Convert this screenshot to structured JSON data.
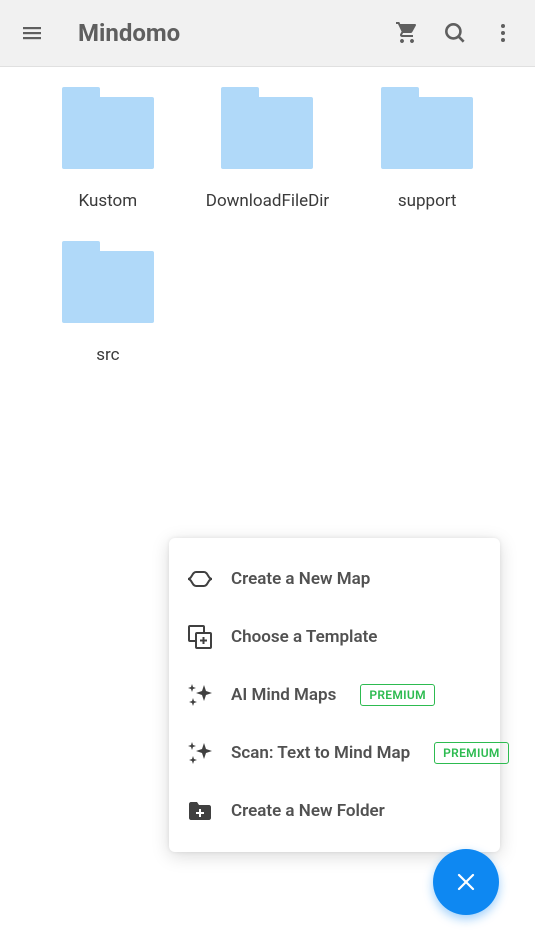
{
  "header": {
    "title": "Mindomo"
  },
  "folders": [
    {
      "label": "Kustom"
    },
    {
      "label": "DownloadFileDir"
    },
    {
      "label": "support"
    },
    {
      "label": "src"
    }
  ],
  "popup": {
    "items": [
      {
        "label": "Create a New Map",
        "icon": "new-map",
        "premium": false
      },
      {
        "label": "Choose a Template",
        "icon": "template",
        "premium": false
      },
      {
        "label": "AI Mind Maps",
        "icon": "sparkle",
        "premium": true
      },
      {
        "label": "Scan: Text to Mind Map",
        "icon": "sparkle",
        "premium": true
      },
      {
        "label": "Create a New Folder",
        "icon": "folder-plus",
        "premium": false
      }
    ],
    "premium_label": "PREMIUM"
  }
}
